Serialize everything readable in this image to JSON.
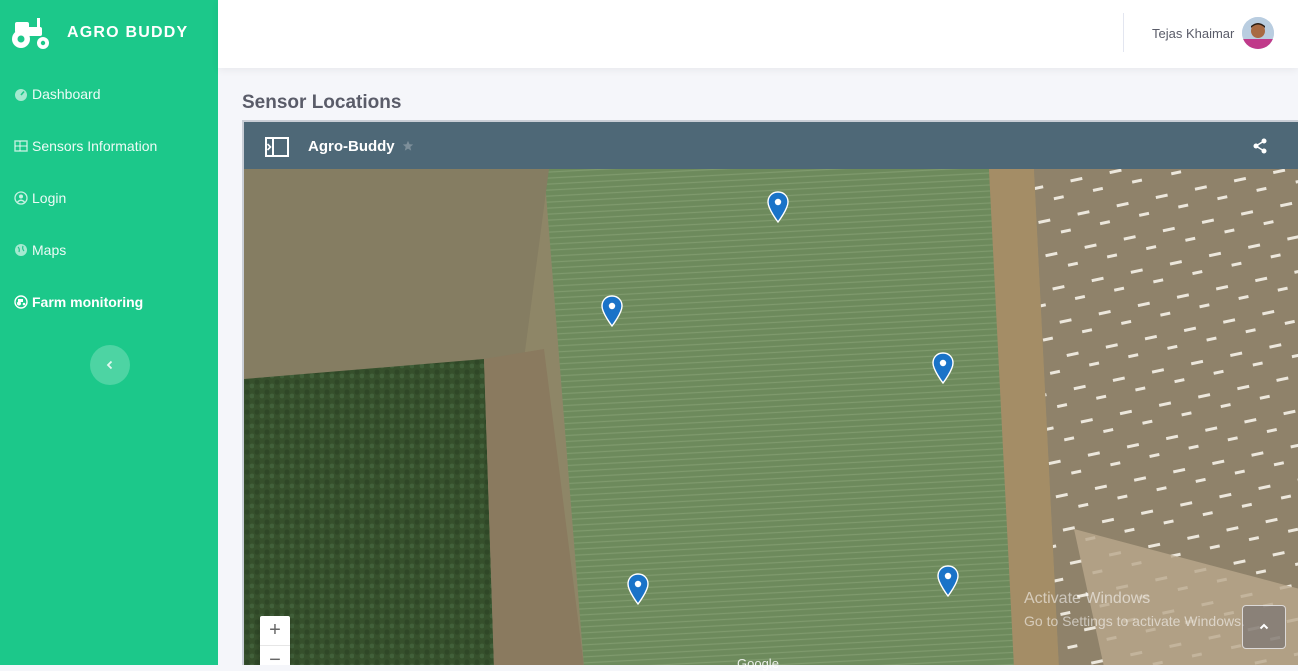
{
  "brand": {
    "name": "AGRO BUDDY",
    "icon": "tractor-icon"
  },
  "sidebar": {
    "items": [
      {
        "label": "Dashboard",
        "icon": "gauge-icon",
        "active": false
      },
      {
        "label": "Sensors Information",
        "icon": "table-icon",
        "active": false
      },
      {
        "label": "Login",
        "icon": "user-circle-icon",
        "active": false
      },
      {
        "label": "Maps",
        "icon": "globe-icon",
        "active": false
      },
      {
        "label": "Farm monitoring",
        "icon": "tractor-mini-icon",
        "active": true
      }
    ],
    "toggle_icon": "chevron-left-icon"
  },
  "topbar": {
    "user_name": "Tejas Khaimar"
  },
  "page": {
    "title": "Sensor Locations"
  },
  "map": {
    "title": "Agro-Buddy",
    "zoom_in": "+",
    "zoom_out": "−",
    "google_attribution": "Google",
    "marker_count": 5
  },
  "watermark": {
    "line1": "Activate Windows",
    "line2": "Go to Settings to activate Windows."
  },
  "colors": {
    "sidebar": "#1cc88a",
    "map_header": "#4e6877",
    "marker": "#1a73c8"
  }
}
